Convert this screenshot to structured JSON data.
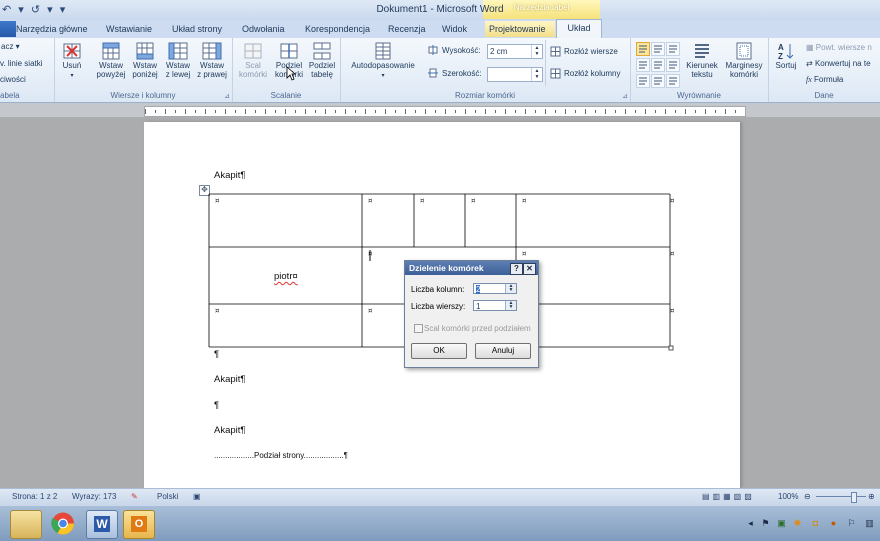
{
  "window": {
    "title": "Dokument1 - Microsoft Word",
    "context_header": "Narzędzia tabel",
    "qat": "↶ ▾ ↺ ▾ ▾"
  },
  "tabs": [
    {
      "label": "Narzędzia główne"
    },
    {
      "label": "Wstawianie"
    },
    {
      "label": "Układ strony"
    },
    {
      "label": "Odwołania"
    },
    {
      "label": "Korespondencja"
    },
    {
      "label": "Recenzja"
    },
    {
      "label": "Widok"
    },
    {
      "label": "Projektowanie"
    },
    {
      "label": "Układ"
    }
  ],
  "ribbon": {
    "table_group": {
      "select": "acz ▾",
      "gridlines": "v. linie siatki",
      "properties": "ciwości",
      "label": "abela"
    },
    "rows_cols": {
      "delete": "Usuń",
      "insert_above": [
        "Wstaw",
        "powyżej"
      ],
      "insert_below": [
        "Wstaw",
        "poniżej"
      ],
      "insert_left": [
        "Wstaw",
        "z lewej"
      ],
      "insert_right": [
        "Wstaw",
        "z prawej"
      ],
      "label": "Wiersze i kolumny"
    },
    "merge": {
      "merge_cells": [
        "Scal",
        "komórki"
      ],
      "split_cells": [
        "Podziel",
        "komórki"
      ],
      "split_table": [
        "Podziel",
        "tabelę"
      ],
      "label": "Scalanie"
    },
    "cell_size": {
      "autofit": "Autodopasowanie",
      "height_label": "Wysokość:",
      "height_value": "2 cm",
      "width_label": "Szerokość:",
      "width_value": "",
      "distribute_rows": "Rozłóż wiersze",
      "distribute_cols": "Rozłóż kolumny",
      "label": "Rozmiar komórki"
    },
    "alignment": {
      "text_direction": [
        "Kierunek",
        "tekstu"
      ],
      "cell_margins": [
        "Marginesy",
        "komórki"
      ],
      "label": "Wyrównanie"
    },
    "data": {
      "sort": "Sortuj",
      "repeat_header": "Powt. wiersze n",
      "convert": "Konwertuj na te",
      "formula": "Formuła",
      "label": "Dane"
    }
  },
  "document": {
    "para1": "Akapit¶",
    "cell_text": "piotr¤",
    "after_table": "¶",
    "para2": "Akapit¶",
    "para3": "¶",
    "para4": "Akapit¶",
    "page_break": "..................Podział strony..................¶",
    "cell_mark": "¤",
    "table": {
      "rows": 3,
      "note": "row 1 has 5 cells, rows 2-3 have 3 cells"
    }
  },
  "dialog": {
    "title": "Dzielenie komórek",
    "help": "?",
    "close": "✕",
    "cols_label": "Liczba kolumn:",
    "cols_value": "2",
    "rows_label": "Liczba wierszy:",
    "rows_value": "1",
    "merge_label": "Scal komórki przed podziałem",
    "ok": "OK",
    "cancel": "Anuluj"
  },
  "status": {
    "page": "Strona: 1 z 2",
    "words": "Wyrazy: 173",
    "language": "Polski",
    "zoom": "100%"
  },
  "colors": {
    "accent": "#2758a9",
    "context": "#f6e27a"
  }
}
